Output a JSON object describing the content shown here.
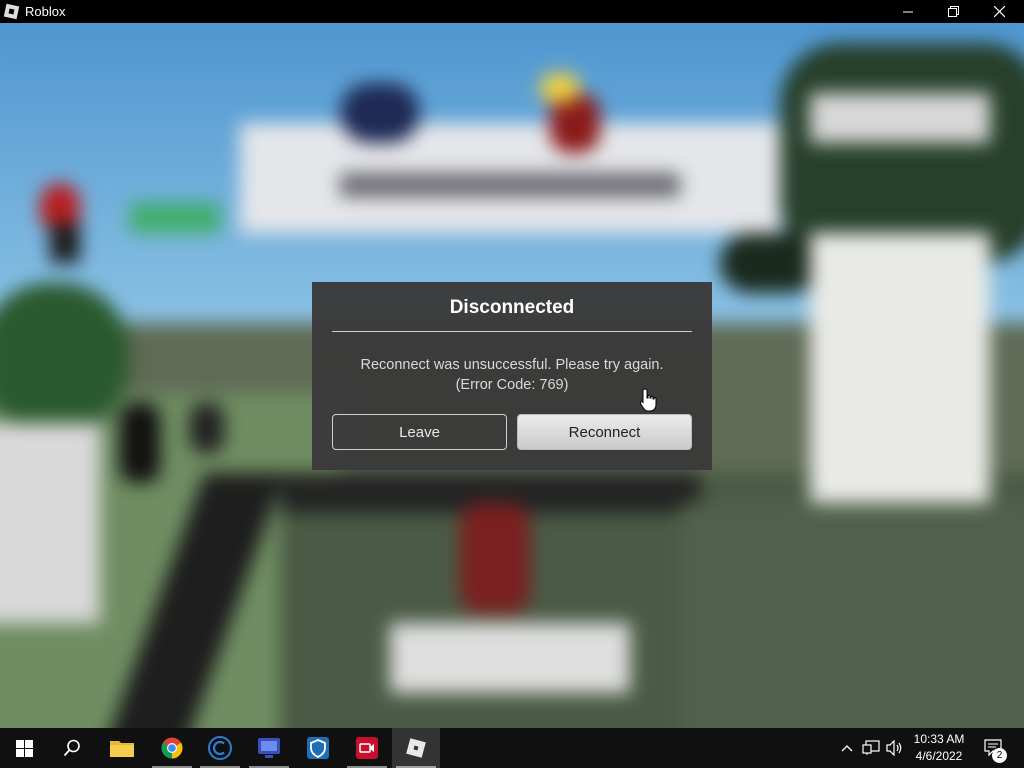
{
  "window": {
    "title": "Roblox",
    "controls": [
      "minimize",
      "restore",
      "close"
    ]
  },
  "dialog": {
    "title": "Disconnected",
    "message_line1": "Reconnect was unsuccessful. Please try again.",
    "message_line2": "(Error Code: 769)",
    "leave_label": "Leave",
    "reconnect_label": "Reconnect"
  },
  "taskbar": {
    "apps": [
      {
        "name": "start-icon"
      },
      {
        "name": "search-icon"
      },
      {
        "name": "file-explorer-icon"
      },
      {
        "name": "chrome-icon"
      },
      {
        "name": "ccleaner-icon"
      },
      {
        "name": "remote-app-icon"
      },
      {
        "name": "shield-app-icon"
      },
      {
        "name": "screen-recorder-icon"
      },
      {
        "name": "roblox-icon"
      }
    ],
    "clock": {
      "time": "10:33 AM",
      "date": "4/6/2022"
    },
    "notification_count": "2"
  },
  "colors": {
    "dialog_bg": "#3a3a3a",
    "taskbar_bg": "#101010",
    "accent_blue": "#4a90d9"
  }
}
